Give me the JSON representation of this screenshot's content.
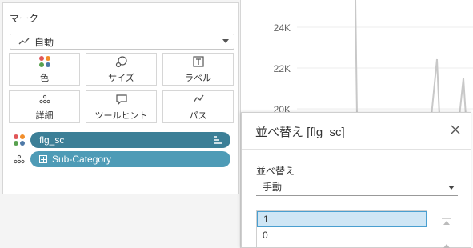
{
  "marks": {
    "title": "マーク",
    "mark_type": "自動",
    "cards": [
      {
        "label": "色",
        "icon": "color-icon"
      },
      {
        "label": "サイズ",
        "icon": "size-icon"
      },
      {
        "label": "ラベル",
        "icon": "label-icon"
      },
      {
        "label": "詳細",
        "icon": "detail-icon"
      },
      {
        "label": "ツールヒント",
        "icon": "tooltip-icon"
      },
      {
        "label": "パス",
        "icon": "path-icon"
      }
    ],
    "pills": [
      {
        "field": "flg_sc",
        "icon": "color-icon",
        "style": "dark"
      },
      {
        "field": "Sub-Category",
        "icon": "detail-icon",
        "style": "light"
      }
    ]
  },
  "chart": {
    "y_ticks": [
      "24K",
      "22K",
      "20K"
    ]
  },
  "sort_dialog": {
    "title": "並べ替え [flg_sc]",
    "sort_label": "並べ替え",
    "sort_value": "手動",
    "items": [
      "1",
      "0"
    ],
    "selected_index": 0
  },
  "colors": {
    "pill_dark": "#3c7f97",
    "pill_light": "#4e9bb6",
    "selection": "#cfe6f5"
  }
}
